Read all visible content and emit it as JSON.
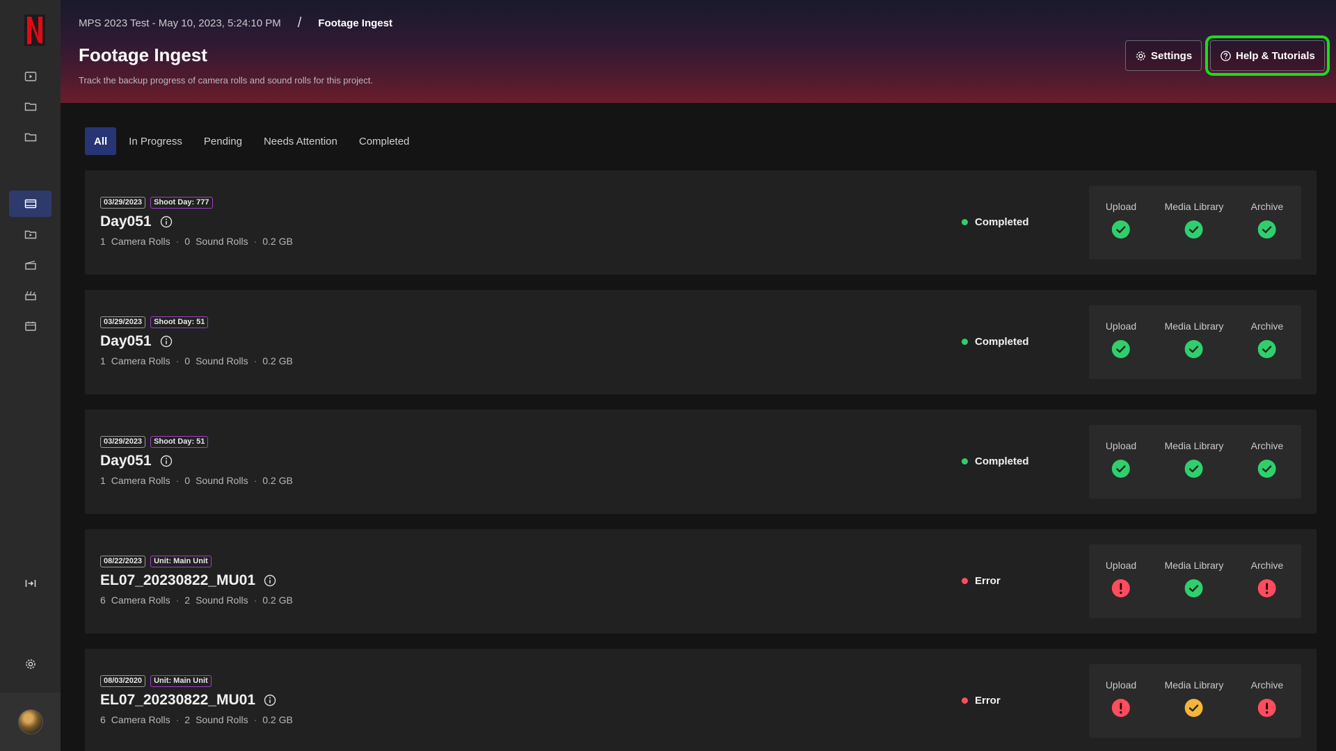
{
  "header": {
    "breadcrumb_project": "MPS 2023 Test - May 10, 2023, 5:24:10 PM",
    "breadcrumb_sep": "/",
    "breadcrumb_current": "Footage Ingest",
    "title": "Footage Ingest",
    "subtitle": "Track the backup progress of camera rolls and sound rolls for this project.",
    "settings_label": "Settings",
    "help_label": "Help & Tutorials"
  },
  "tabs": [
    {
      "label": "All",
      "active": true
    },
    {
      "label": "In Progress",
      "active": false
    },
    {
      "label": "Pending",
      "active": false
    },
    {
      "label": "Needs Attention",
      "active": false
    },
    {
      "label": "Completed",
      "active": false
    }
  ],
  "stage_labels": [
    "Upload",
    "Media Library",
    "Archive"
  ],
  "status_colors": {
    "Completed": "#2fcf6e",
    "Error": "#ff4d5e"
  },
  "stage_icon_colors": {
    "check": "#2fcf6e",
    "error": "#ff4d5e",
    "warning-check": "#f5b43a"
  },
  "cards": [
    {
      "date": "03/29/2023",
      "tag": "Shoot Day: 777",
      "name": "Day051",
      "camera_rolls": "1",
      "camera_rolls_label": "Camera Rolls",
      "sound_rolls": "0",
      "sound_rolls_label": "Sound Rolls",
      "size": "0.2 GB",
      "status": "Completed",
      "stages": [
        "check",
        "check",
        "check"
      ]
    },
    {
      "date": "03/29/2023",
      "tag": "Shoot Day: 51",
      "name": "Day051",
      "camera_rolls": "1",
      "camera_rolls_label": "Camera Rolls",
      "sound_rolls": "0",
      "sound_rolls_label": "Sound Rolls",
      "size": "0.2 GB",
      "status": "Completed",
      "stages": [
        "check",
        "check",
        "check"
      ]
    },
    {
      "date": "03/29/2023",
      "tag": "Shoot Day: 51",
      "name": "Day051",
      "camera_rolls": "1",
      "camera_rolls_label": "Camera Rolls",
      "sound_rolls": "0",
      "sound_rolls_label": "Sound Rolls",
      "size": "0.2 GB",
      "status": "Completed",
      "stages": [
        "check",
        "check",
        "check"
      ]
    },
    {
      "date": "08/22/2023",
      "tag": "Unit: Main Unit",
      "name": "EL07_20230822_MU01",
      "camera_rolls": "6",
      "camera_rolls_label": "Camera Rolls",
      "sound_rolls": "2",
      "sound_rolls_label": "Sound Rolls",
      "size": "0.2 GB",
      "status": "Error",
      "stages": [
        "error",
        "check",
        "error"
      ]
    },
    {
      "date": "08/03/2020",
      "tag": "Unit: Main Unit",
      "name": "EL07_20230822_MU01",
      "camera_rolls": "6",
      "camera_rolls_label": "Camera Rolls",
      "sound_rolls": "2",
      "sound_rolls_label": "Sound Rolls",
      "size": "0.2 GB",
      "status": "Error",
      "stages": [
        "error",
        "warning-check",
        "error"
      ]
    }
  ],
  "sidebar": {
    "icons": [
      "play-square-icon",
      "folder-icon",
      "folder-icon",
      "film-icon",
      "play-folder-icon",
      "clapperboard-icon",
      "clapperboard-icon",
      "calendar-icon",
      "collapse-sidebar-icon",
      "gear-icon"
    ],
    "active_index": 3
  }
}
